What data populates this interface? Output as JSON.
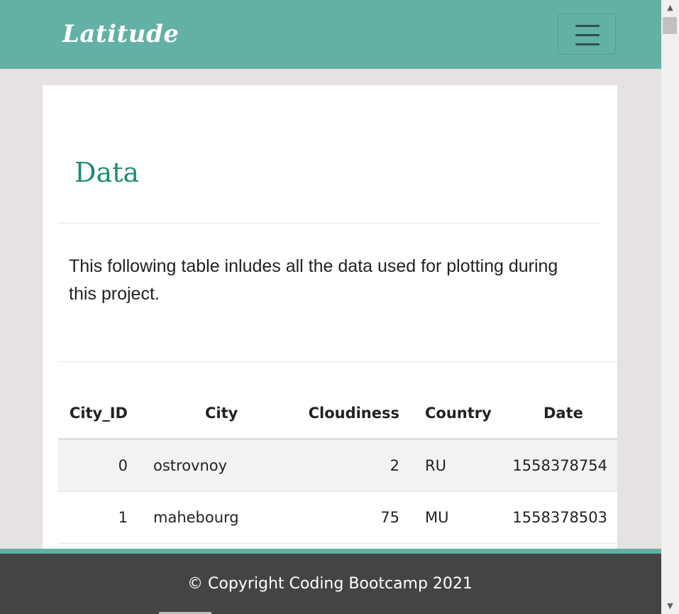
{
  "navbar": {
    "brand": "Latitude",
    "menu_icon": "hamburger-menu-icon"
  },
  "main": {
    "title": "Data",
    "description": "This following table inludes all the data used for plotting during this project."
  },
  "table": {
    "headers": [
      "City_ID",
      "City",
      "Cloudiness",
      "Country",
      "Date"
    ],
    "rows": [
      [
        "0",
        "ostrovnoy",
        "2",
        "RU",
        "1558378754"
      ],
      [
        "1",
        "mahebourg",
        "75",
        "MU",
        "1558378503"
      ]
    ]
  },
  "footer": {
    "text": "© Copyright Coding Bootcamp 2021"
  },
  "colors": {
    "accent": "#63b1a4",
    "title": "#1f8a78",
    "footer_bg": "#444444",
    "page_bg": "#e7e2e2"
  },
  "scrollbar": {
    "up_icon": "scroll-up-arrow-icon",
    "down_icon": "scroll-down-arrow-icon"
  }
}
